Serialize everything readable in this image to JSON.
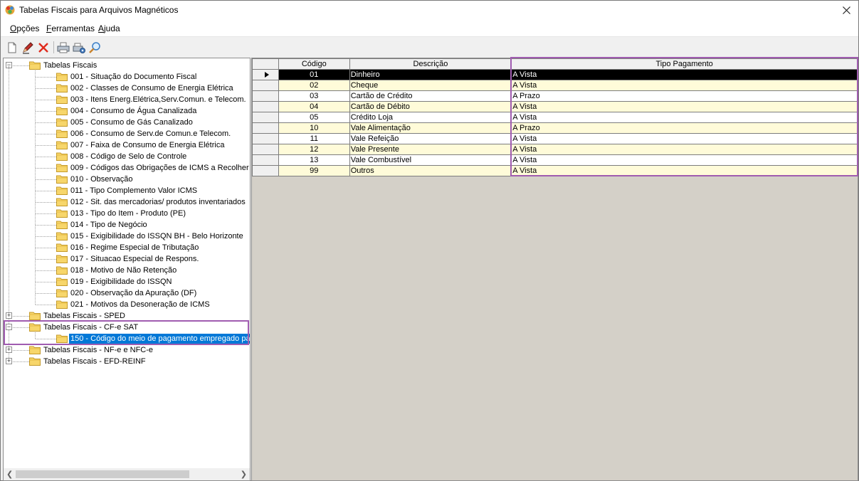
{
  "window": {
    "title": "Tabelas Fiscais para Arquivos Magnéticos",
    "close_icon": "close-icon"
  },
  "menu": {
    "items": [
      {
        "underline": "O",
        "rest": "pções"
      },
      {
        "underline": "F",
        "rest": "erramentas"
      },
      {
        "underline": "A",
        "rest": "juda"
      }
    ]
  },
  "toolbar": {
    "buttons": [
      "new-icon",
      "edit-icon",
      "delete-icon",
      "print-icon",
      "print-setup-icon",
      "search-icon"
    ]
  },
  "tree": {
    "root1": {
      "label": "Tabelas Fiscais",
      "children": [
        "001 - Situação do Documento Fiscal",
        "002 - Classes de Consumo de Energia Elétrica",
        "003 - Itens Energ.Elétrica,Serv.Comun. e Telecom.",
        "004 - Consumo de Água Canalizada",
        "005 - Consumo de Gás Canalizado",
        "006 - Consumo de Serv.de Comun.e Telecom.",
        "007 - Faixa de Consumo de Energia Elétrica",
        "008 - Código de Selo de Controle",
        "009 - Códigos das Obrigações de ICMS a Recolher",
        "010 - Observação",
        "011 - Tipo Complemento Valor ICMS",
        "012 - Sit. das mercadorias/ produtos inventariados",
        "013 - Tipo do Item - Produto (PE)",
        "014 - Tipo de Negócio",
        "015 - Exigibilidade do ISSQN BH - Belo Horizonte",
        "016 - Regime Especial de Tributação",
        "017 - Situacao Especial de Respons.",
        "018 - Motivo de Não Retenção",
        "019 - Exigibilidade do ISSQN",
        "020 - Observação da Apuração (DF)",
        "021 - Motivos da Desoneração de ICMS"
      ]
    },
    "sped": "Tabelas Fiscais - SPED",
    "cfe_sat": "Tabelas Fiscais - CF-e SAT",
    "cfe_sat_child": "150 - Código do meio de pagamento empregado pa",
    "nfe": "Tabelas Fiscais - NF-e e NFC-e",
    "efd": "Tabelas Fiscais - EFD-REINF"
  },
  "grid": {
    "headers": [
      "Código",
      "Descrição",
      "Tipo Pagamento"
    ],
    "rows": [
      {
        "codigo": "01",
        "descricao": "Dinheiro",
        "tipo": "A Vista"
      },
      {
        "codigo": "02",
        "descricao": "Cheque",
        "tipo": "A Vista"
      },
      {
        "codigo": "03",
        "descricao": "Cartão de Crédito",
        "tipo": "A Prazo"
      },
      {
        "codigo": "04",
        "descricao": "Cartão de Débito",
        "tipo": "A Vista"
      },
      {
        "codigo": "05",
        "descricao": "Crédito Loja",
        "tipo": "A Vista"
      },
      {
        "codigo": "10",
        "descricao": "Vale Alimentação",
        "tipo": "A Prazo"
      },
      {
        "codigo": "11",
        "descricao": "Vale Refeição",
        "tipo": "A Vista"
      },
      {
        "codigo": "12",
        "descricao": "Vale Presente",
        "tipo": "A Vista"
      },
      {
        "codigo": "13",
        "descricao": "Vale Combustível",
        "tipo": "A Vista"
      },
      {
        "codigo": "99",
        "descricao": "Outros",
        "tipo": "A Vista"
      }
    ],
    "selected_row": 0
  },
  "colors": {
    "highlight": "#a05cb0",
    "row_alt": "#fffbd9",
    "selection": "#0078d7",
    "grid_background": "#d4d0c8"
  }
}
